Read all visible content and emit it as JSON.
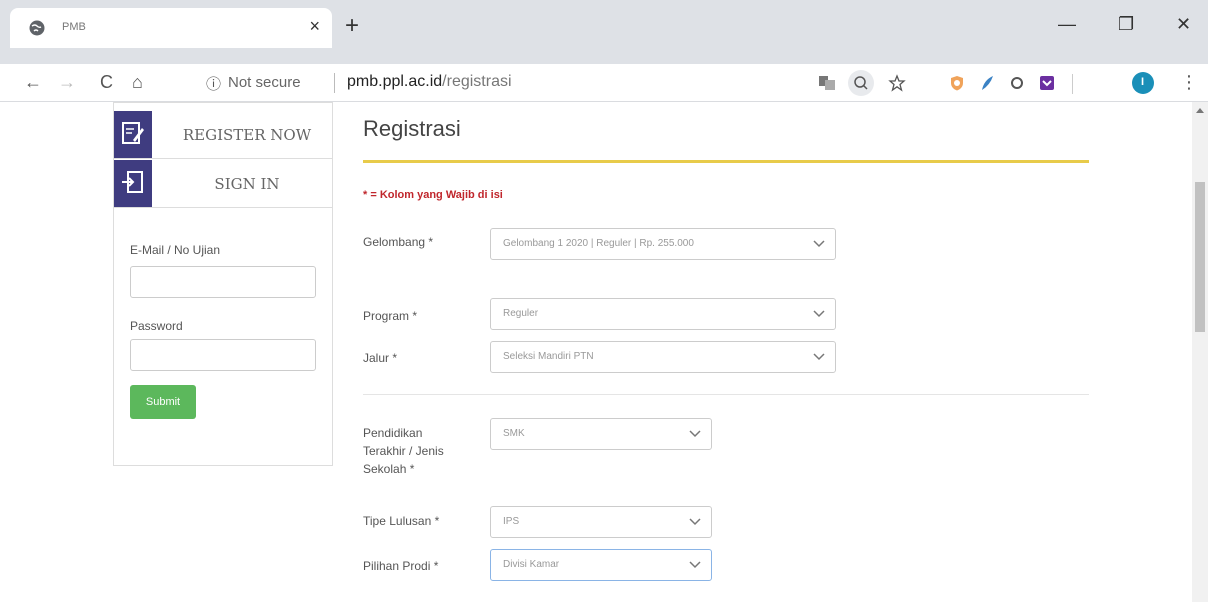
{
  "browser": {
    "tab_title": "PMB",
    "tab_close": "×",
    "new_tab": "+",
    "minimize": "—",
    "maximize": "❐",
    "close": "✕",
    "back": "←",
    "forward": "→",
    "reload": "C",
    "home": "⌂",
    "info_icon": "ⓘ",
    "security_text": "Not secure",
    "url_host": "pmb.ppl.ac.id",
    "url_path": "/registrasi",
    "kebab": "⋮",
    "profile_initial": "I"
  },
  "sidebar": {
    "register_label": "REGISTER NOW",
    "signin_label": "SIGN IN",
    "email_label": "E-Mail / No Ujian",
    "email_value": "",
    "password_label": "Password",
    "password_value": "",
    "submit_label": "Submit"
  },
  "form": {
    "title": "Registrasi",
    "required_note": "* = Kolom yang Wajib di isi",
    "fields": [
      {
        "label": "Gelombang *",
        "value": "Gelombang 1 2020 | Reguler | Rp. 255.000"
      },
      {
        "label": "Program *",
        "value": "Reguler"
      },
      {
        "label": "Jalur *",
        "value": "Seleksi Mandiri PTN"
      },
      {
        "label": "Pendidikan Terakhir / Jenis Sekolah *",
        "value": "SMK"
      },
      {
        "label": "Tipe Lulusan *",
        "value": "IPS"
      },
      {
        "label": "Pilihan Prodi *",
        "value": "Divisi Kamar"
      }
    ]
  },
  "colors": {
    "accent_gold": "#e8cb4a",
    "sidebar_icon_bg": "#3f3c80",
    "submit_green": "#5cb85c",
    "required_red": "#c0262c"
  }
}
